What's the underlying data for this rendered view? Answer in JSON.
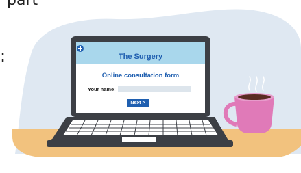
{
  "fragment_text": "part",
  "colon_text": ":",
  "surgery": {
    "name": "The Surgery",
    "icon": "plus-circle-icon"
  },
  "form": {
    "title": "Online consultation form",
    "name_label": "Your name:",
    "name_value": "",
    "next_label": "Next >"
  },
  "colors": {
    "background_blob": "#dfe8f2",
    "desk": "#f2c27e",
    "laptop_body": "#3c3f45",
    "screen_header": "#a9d7ec",
    "brand_blue": "#1f5fb0",
    "mug": "#e07ab8"
  }
}
